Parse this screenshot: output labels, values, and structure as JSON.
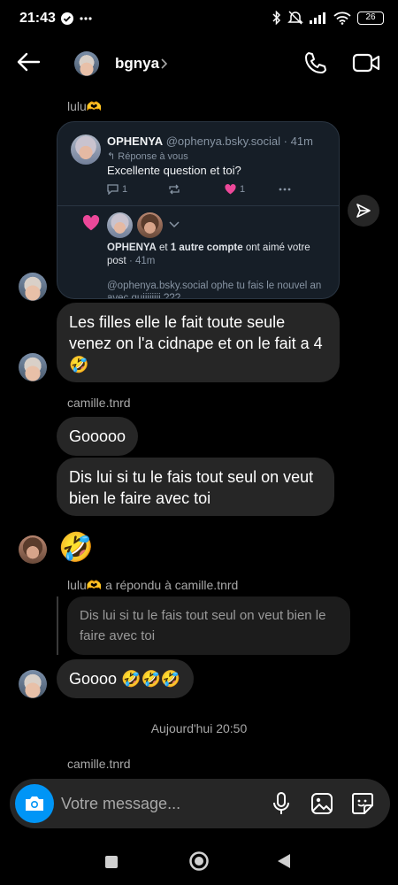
{
  "status_bar": {
    "time": "21:43",
    "battery": "26"
  },
  "header": {
    "contact_name": "bgnya",
    "icons": [
      "back-arrow-icon",
      "chevron-right-icon",
      "phone-icon",
      "video-camera-icon"
    ]
  },
  "conversation": {
    "sender_lulu": "lulu🫶",
    "shared_post": {
      "author_name": "OPHENYA",
      "author_handle": "@ophenya.bsky.social",
      "post_age": "41m",
      "reply_indicator": "Réponse à vous",
      "text": "Excellente question et toi?",
      "reply_count": "1",
      "like_count": "1",
      "notification_name": "OPHENYA",
      "notification_joiner": " et ",
      "notification_others": "1 autre compte",
      "notification_action": " ont aimé votre post",
      "notification_age": " · 41m",
      "reply_text": "@ophenya.bsky.social ophe tu fais le nouvel an avec quiiiiiiii ???"
    },
    "msg_lulu_1": "Les filles elle le fait toute seule venez on l'a cidnape et on le fait a 4 🤣",
    "sender_camille": "camille.tnrd",
    "msg_camille_1": "Gooooo",
    "msg_camille_2": "Dis lui si tu le fais tout seul on veut bien le faire avec toi",
    "msg_emoji": "🤣",
    "reply_meta_user": "lulu🫶",
    "reply_meta_text": " a répondu à camille.tnrd",
    "quoted_text": "Dis lui si tu le fais tout seul on veut bien le faire avec toi",
    "msg_lulu_2": "Goooo 🤣🤣🤣",
    "timestamp": "Aujourd'hui 20:50",
    "sender_camille_2": "camille.tnrd"
  },
  "composer": {
    "placeholder": "Votre message..."
  },
  "colors": {
    "accent": "#0095f6",
    "bubble": "#262626",
    "card_bg": "#161e27",
    "like_pink": "#ec4899"
  }
}
